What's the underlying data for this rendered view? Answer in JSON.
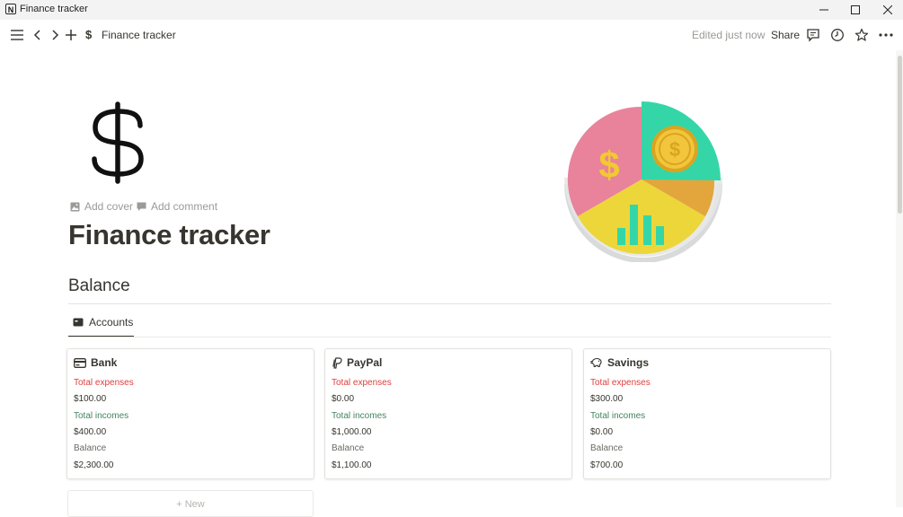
{
  "window": {
    "title": "Finance tracker",
    "app_icon_letter": "N"
  },
  "toolbar": {
    "breadcrumb": "Finance tracker",
    "breadcrumb_icon": "$",
    "edited": "Edited just now",
    "share": "Share"
  },
  "page": {
    "add_cover": "Add cover",
    "add_comment": "Add comment",
    "title": "Finance tracker",
    "section_heading": "Balance",
    "tab_label": "Accounts",
    "new_label": "New"
  },
  "cards": [
    {
      "name": "Bank",
      "icon": "bank-card-icon",
      "expenses_label": "Total expenses",
      "expenses": "$100.00",
      "incomes_label": "Total incomes",
      "incomes": "$400.00",
      "balance_label": "Balance",
      "balance": "$2,300.00"
    },
    {
      "name": "PayPal",
      "icon": "paypal-icon",
      "expenses_label": "Total expenses",
      "expenses": "$0.00",
      "incomes_label": "Total incomes",
      "incomes": "$1,000.00",
      "balance_label": "Balance",
      "balance": "$1,100.00"
    },
    {
      "name": "Savings",
      "icon": "piggy-bank-icon",
      "expenses_label": "Total expenses",
      "expenses": "$300.00",
      "incomes_label": "Total incomes",
      "incomes": "$0.00",
      "balance_label": "Balance",
      "balance": "$700.00"
    }
  ],
  "colors": {
    "expenses": "#e03e3e",
    "incomes": "#448361",
    "pie_pink": "#e8839b",
    "pie_teal": "#34d6a8",
    "pie_yellow": "#ecd63a",
    "pie_orange": "#e2a63c"
  }
}
